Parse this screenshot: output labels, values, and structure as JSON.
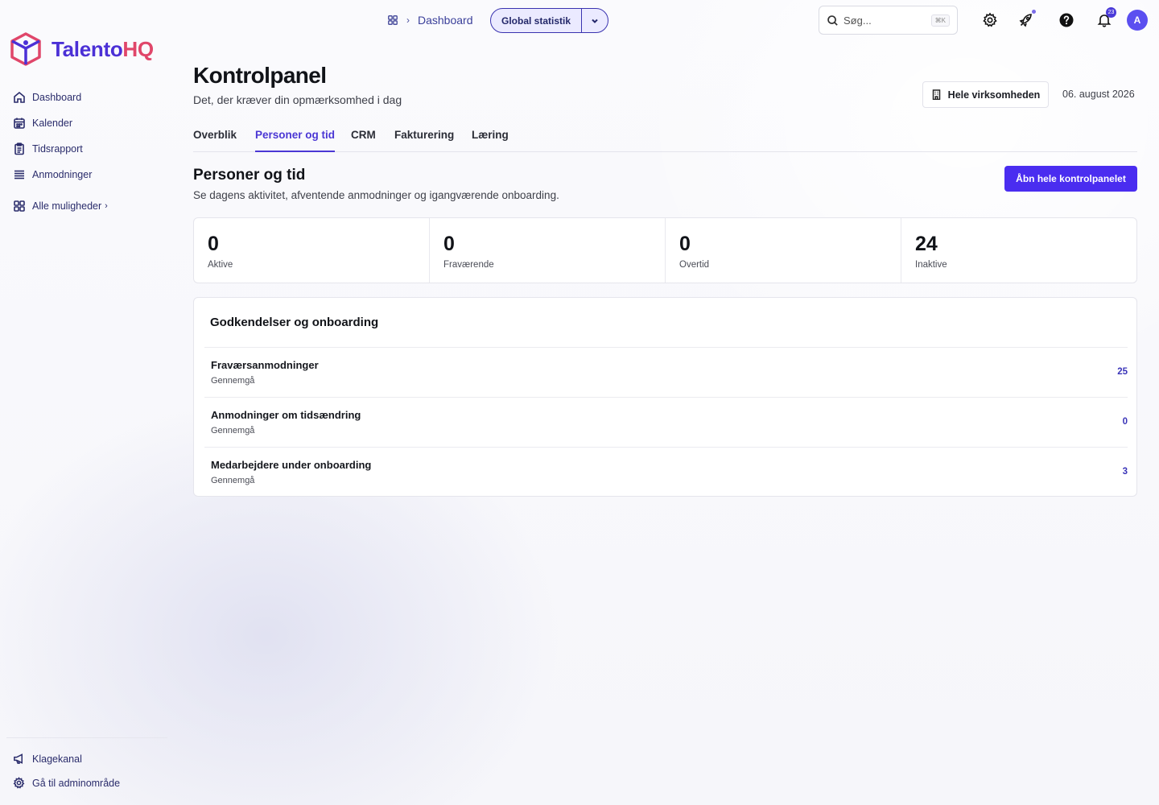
{
  "brand": {
    "name_part1": "Talento",
    "name_part2": "HQ",
    "color_primary": "#4b30d6",
    "color_accent": "#e0466a"
  },
  "sidebar": {
    "items": [
      {
        "label": "Dashboard",
        "icon": "home-icon"
      },
      {
        "label": "Kalender",
        "icon": "calendar-icon"
      },
      {
        "label": "Tidsrapport",
        "icon": "clipboard-icon"
      },
      {
        "label": "Anmodninger",
        "icon": "list-icon"
      }
    ],
    "more_label": "Alle muligheder",
    "footer": [
      {
        "label": "Klagekanal",
        "icon": "megaphone-icon"
      },
      {
        "label": "Gå til adminområde",
        "icon": "gear-icon"
      }
    ]
  },
  "topbar": {
    "breadcrumb_link": "Dashboard",
    "scope_label": "Global statistik",
    "search_placeholder": "Søg...",
    "search_shortcut": "⌘K",
    "notification_count": "23",
    "avatar_initial": "A"
  },
  "header": {
    "title": "Kontrolpanel",
    "subtitle": "Det, der kræver din opmærksomhed i dag",
    "scope_button": "Hele virksomheden",
    "date": "06. august 2026"
  },
  "tabs": [
    {
      "label": "Overblik",
      "active": false
    },
    {
      "label": "Personer og tid",
      "active": true
    },
    {
      "label": "CRM",
      "active": false
    },
    {
      "label": "Fakturering",
      "active": false
    },
    {
      "label": "Læring",
      "active": false
    }
  ],
  "section": {
    "title": "Personer og tid",
    "subtitle": "Se dagens aktivitet, afventende anmodninger og igangværende onboarding.",
    "open_button": "Åbn hele kontrolpanelet"
  },
  "stats": [
    {
      "value": "0",
      "label": "Aktive"
    },
    {
      "value": "0",
      "label": "Fraværende"
    },
    {
      "value": "0",
      "label": "Overtid"
    },
    {
      "value": "24",
      "label": "Inaktive"
    }
  ],
  "approvals": {
    "title": "Godkendelser og onboarding",
    "rows": [
      {
        "title": "Fraværsanmodninger",
        "sub": "Gennemgå",
        "count": "25"
      },
      {
        "title": "Anmodninger om tidsændring",
        "sub": "Gennemgå",
        "count": "0"
      },
      {
        "title": "Medarbejdere under onboarding",
        "sub": "Gennemgå",
        "count": "3"
      }
    ]
  }
}
